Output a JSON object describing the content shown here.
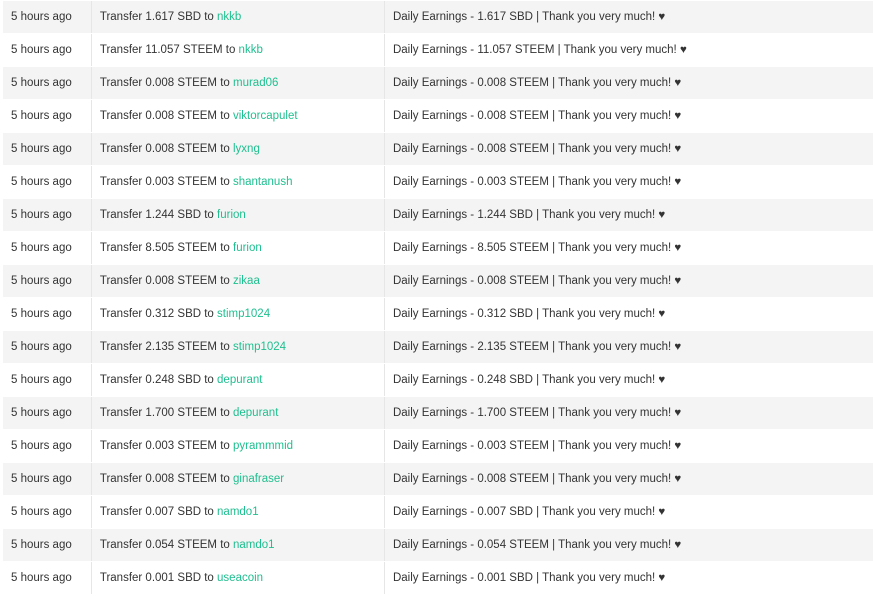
{
  "history": {
    "rows": [
      {
        "time": "5 hours ago",
        "prefix": "Transfer 1.617 SBD to ",
        "account": "nkkb",
        "memo": "Daily Earnings - 1.617 SBD | Thank you very much! ♥"
      },
      {
        "time": "5 hours ago",
        "prefix": "Transfer 11.057 STEEM to ",
        "account": "nkkb",
        "memo": "Daily Earnings - 11.057 STEEM | Thank you very much! ♥"
      },
      {
        "time": "5 hours ago",
        "prefix": "Transfer 0.008 STEEM to ",
        "account": "murad06",
        "memo": "Daily Earnings - 0.008 STEEM | Thank you very much! ♥"
      },
      {
        "time": "5 hours ago",
        "prefix": "Transfer 0.008 STEEM to ",
        "account": "viktorcapulet",
        "memo": "Daily Earnings - 0.008 STEEM | Thank you very much! ♥"
      },
      {
        "time": "5 hours ago",
        "prefix": "Transfer 0.008 STEEM to ",
        "account": "lyxng",
        "memo": "Daily Earnings - 0.008 STEEM | Thank you very much! ♥"
      },
      {
        "time": "5 hours ago",
        "prefix": "Transfer 0.003 STEEM to ",
        "account": "shantanush",
        "memo": "Daily Earnings - 0.003 STEEM | Thank you very much! ♥"
      },
      {
        "time": "5 hours ago",
        "prefix": "Transfer 1.244 SBD to ",
        "account": "furion",
        "memo": "Daily Earnings - 1.244 SBD | Thank you very much! ♥"
      },
      {
        "time": "5 hours ago",
        "prefix": "Transfer 8.505 STEEM to ",
        "account": "furion",
        "memo": "Daily Earnings - 8.505 STEEM | Thank you very much! ♥"
      },
      {
        "time": "5 hours ago",
        "prefix": "Transfer 0.008 STEEM to ",
        "account": "zikaa",
        "memo": "Daily Earnings - 0.008 STEEM | Thank you very much! ♥"
      },
      {
        "time": "5 hours ago",
        "prefix": "Transfer 0.312 SBD to ",
        "account": "stimp1024",
        "memo": "Daily Earnings - 0.312 SBD | Thank you very much! ♥"
      },
      {
        "time": "5 hours ago",
        "prefix": "Transfer 2.135 STEEM to ",
        "account": "stimp1024",
        "memo": "Daily Earnings - 2.135 STEEM | Thank you very much! ♥"
      },
      {
        "time": "5 hours ago",
        "prefix": "Transfer 0.248 SBD to ",
        "account": "depurant",
        "memo": "Daily Earnings - 0.248 SBD | Thank you very much! ♥"
      },
      {
        "time": "5 hours ago",
        "prefix": "Transfer 1.700 STEEM to ",
        "account": "depurant",
        "memo": "Daily Earnings - 1.700 STEEM | Thank you very much! ♥"
      },
      {
        "time": "5 hours ago",
        "prefix": "Transfer 0.003 STEEM to ",
        "account": "pyrammmid",
        "memo": "Daily Earnings - 0.003 STEEM | Thank you very much! ♥"
      },
      {
        "time": "5 hours ago",
        "prefix": "Transfer 0.008 STEEM to ",
        "account": "ginafraser",
        "memo": "Daily Earnings - 0.008 STEEM | Thank you very much! ♥"
      },
      {
        "time": "5 hours ago",
        "prefix": "Transfer 0.007 SBD to ",
        "account": "namdo1",
        "memo": "Daily Earnings - 0.007 SBD | Thank you very much! ♥"
      },
      {
        "time": "5 hours ago",
        "prefix": "Transfer 0.054 STEEM to ",
        "account": "namdo1",
        "memo": "Daily Earnings - 0.054 STEEM | Thank you very much! ♥"
      },
      {
        "time": "5 hours ago",
        "prefix": "Transfer 0.001 SBD to ",
        "account": "useacoin",
        "memo": "Daily Earnings - 0.001 SBD | Thank you very much! ♥"
      }
    ]
  },
  "colors": {
    "link": "#1fbf8f",
    "text": "#333333",
    "row_stripe": "#f4f4f4"
  }
}
